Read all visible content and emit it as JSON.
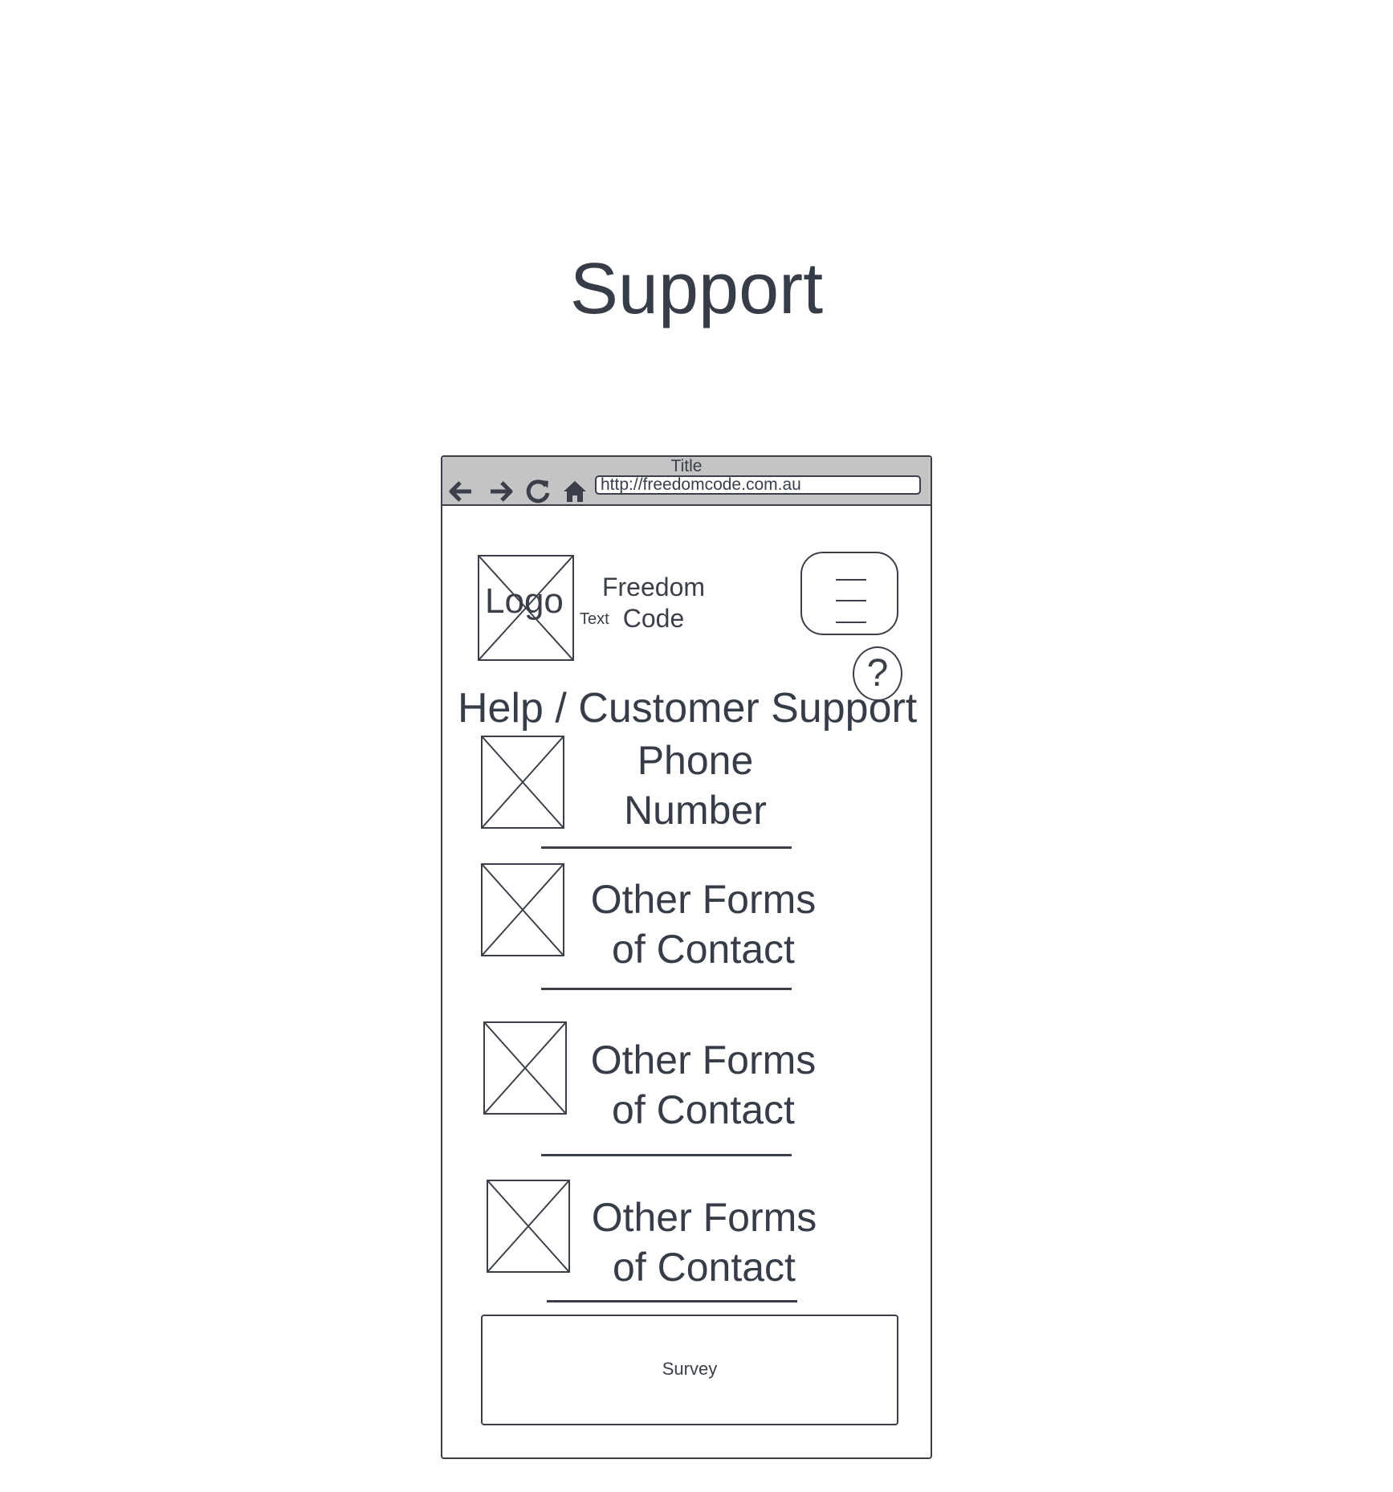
{
  "page": {
    "title": "Support"
  },
  "browser": {
    "window_title": "Title",
    "url": "http://freedomcode.com.au",
    "nav_icons": [
      "back-arrow-icon",
      "forward-arrow-icon",
      "reload-icon",
      "home-icon"
    ]
  },
  "header": {
    "logo_label": "Logo",
    "brand_name": "Freedom Code",
    "text_label": "Text",
    "menu_icon": "hamburger-menu-icon",
    "help_label": "?"
  },
  "content": {
    "heading": "Help / Customer Support",
    "contacts": [
      {
        "label": "Phone Number"
      },
      {
        "label": "Other Forms of Contact"
      },
      {
        "label": "Other Forms of Contact"
      },
      {
        "label": "Other Forms of Contact"
      }
    ],
    "survey_label": "Survey"
  }
}
